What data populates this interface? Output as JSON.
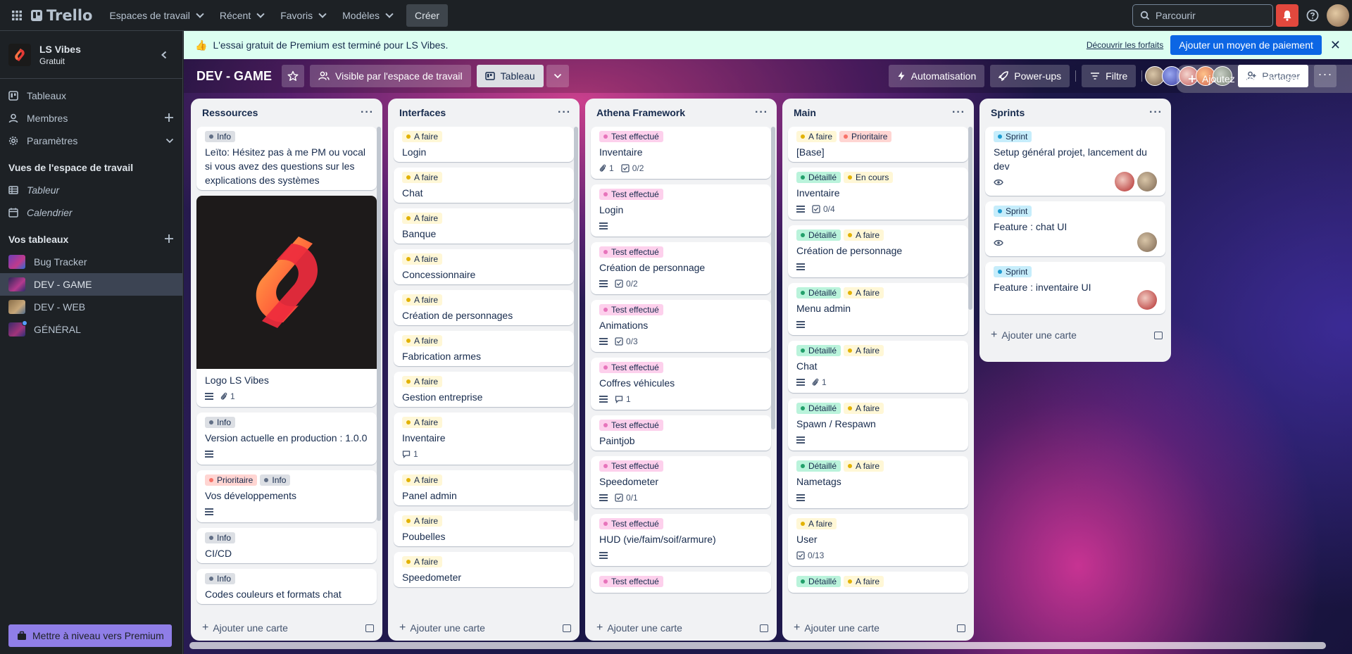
{
  "topbar": {
    "brand": "Trello",
    "nav": [
      "Espaces de travail",
      "Récent",
      "Favoris",
      "Modèles"
    ],
    "create": "Créer",
    "search_placeholder": "Parcourir"
  },
  "sidebar": {
    "workspace_name": "LS Vibes",
    "workspace_plan": "Gratuit",
    "items": [
      {
        "label": "Tableaux",
        "icon": "trello-board-icon"
      },
      {
        "label": "Membres",
        "icon": "person-icon"
      },
      {
        "label": "Paramètres",
        "icon": "gear-icon"
      }
    ],
    "views_title": "Vues de l'espace de travail",
    "views": [
      "Tableur",
      "Calendrier"
    ],
    "boards_title": "Vos tableaux",
    "boards": [
      "Bug Tracker",
      "DEV - GAME",
      "DEV - WEB",
      "GÉNÉRAL"
    ],
    "premium": "Mettre à niveau vers Premium"
  },
  "banner": {
    "text": "L'essai gratuit de Premium est terminé pour LS Vibes.",
    "link": "Découvrir les forfaits",
    "button": "Ajouter un moyen de paiement"
  },
  "board": {
    "title": "DEV - GAME",
    "visibility": "Visible par l'espace de travail",
    "view": "Tableau",
    "automation": "Automatisation",
    "powerups": "Power-ups",
    "filter": "Filtre",
    "share": "Partager",
    "add_list": "Ajoutez une autre liste",
    "add_card": "Ajouter une carte"
  },
  "lists": [
    {
      "name": "Ressources",
      "cards": [
        {
          "labels": [
            "Info"
          ],
          "title": "Leïto: Hésitez pas à me PM ou vocal si vous avez des questions sur les explications des systèmes"
        },
        {
          "cover": true,
          "title": "Logo LS Vibes",
          "desc": true,
          "attach": "1"
        },
        {
          "labels": [
            "Info"
          ],
          "title": "Version actuelle en production : 1.0.0",
          "desc": true
        },
        {
          "labels": [
            "Prioritaire",
            "Info"
          ],
          "title": "Vos développements",
          "desc": true
        },
        {
          "labels": [
            "Info"
          ],
          "title": "CI/CD"
        },
        {
          "labels": [
            "Info"
          ],
          "title": "Codes couleurs et formats chat"
        }
      ]
    },
    {
      "name": "Interfaces",
      "cards": [
        {
          "labels": [
            "A faire"
          ],
          "title": "Login"
        },
        {
          "labels": [
            "A faire"
          ],
          "title": "Chat"
        },
        {
          "labels": [
            "A faire"
          ],
          "title": "Banque"
        },
        {
          "labels": [
            "A faire"
          ],
          "title": "Concessionnaire"
        },
        {
          "labels": [
            "A faire"
          ],
          "title": "Création de personnages"
        },
        {
          "labels": [
            "A faire"
          ],
          "title": "Fabrication armes"
        },
        {
          "labels": [
            "A faire"
          ],
          "title": "Gestion entreprise"
        },
        {
          "labels": [
            "A faire"
          ],
          "title": "Inventaire",
          "comments": "1"
        },
        {
          "labels": [
            "A faire"
          ],
          "title": "Panel admin"
        },
        {
          "labels": [
            "A faire"
          ],
          "title": "Poubelles"
        },
        {
          "labels": [
            "A faire"
          ],
          "title": "Speedometer"
        }
      ]
    },
    {
      "name": "Athena Framework",
      "cards": [
        {
          "labels": [
            "Test effectué"
          ],
          "title": "Inventaire",
          "attach": "1",
          "check": "0/2"
        },
        {
          "labels": [
            "Test effectué"
          ],
          "title": "Login",
          "desc": true
        },
        {
          "labels": [
            "Test effectué"
          ],
          "title": "Création de personnage",
          "desc": true,
          "check": "0/2"
        },
        {
          "labels": [
            "Test effectué"
          ],
          "title": "Animations",
          "desc": true,
          "check": "0/3"
        },
        {
          "labels": [
            "Test effectué"
          ],
          "title": "Coffres véhicules",
          "desc": true,
          "comments": "1"
        },
        {
          "labels": [
            "Test effectué"
          ],
          "title": "Paintjob"
        },
        {
          "labels": [
            "Test effectué"
          ],
          "title": "Speedometer",
          "desc": true,
          "check": "0/1"
        },
        {
          "labels": [
            "Test effectué"
          ],
          "title": "HUD (vie/faim/soif/armure)",
          "desc": true
        },
        {
          "labels": [
            "Test effectué"
          ],
          "title": ""
        }
      ]
    },
    {
      "name": "Main",
      "cards": [
        {
          "labels": [
            "A faire",
            "Prioritaire"
          ],
          "title": "[Base]"
        },
        {
          "labels": [
            "Détaillé",
            "En cours"
          ],
          "title": "Inventaire",
          "desc": true,
          "check": "0/4"
        },
        {
          "labels": [
            "Détaillé",
            "A faire"
          ],
          "title": "Création de personnage",
          "desc": true
        },
        {
          "labels": [
            "Détaillé",
            "A faire"
          ],
          "title": "Menu admin",
          "desc": true
        },
        {
          "labels": [
            "Détaillé",
            "A faire"
          ],
          "title": "Chat",
          "desc": true,
          "attach": "1"
        },
        {
          "labels": [
            "Détaillé",
            "A faire"
          ],
          "title": "Spawn / Respawn",
          "desc": true
        },
        {
          "labels": [
            "Détaillé",
            "A faire"
          ],
          "title": "Nametags",
          "desc": true
        },
        {
          "labels": [
            "A faire"
          ],
          "title": "User",
          "check": "0/13"
        },
        {
          "labels": [
            "Détaillé",
            "A faire"
          ],
          "title": ""
        }
      ]
    },
    {
      "name": "Sprints",
      "cards": [
        {
          "labels": [
            "Sprint"
          ],
          "title": "Setup général projet, lancement du dev",
          "watch": true,
          "avatars": 2
        },
        {
          "labels": [
            "Sprint"
          ],
          "title": "Feature : chat UI",
          "watch": true,
          "avatars": 1
        },
        {
          "labels": [
            "Sprint"
          ],
          "title": "Feature : inventaire UI",
          "avatars": 1
        }
      ]
    }
  ],
  "label_styles": {
    "Info": "l-info",
    "A faire": "l-afaire",
    "Test effectué": "l-test",
    "Prioritaire": "l-prio",
    "Détaillé": "l-detail",
    "En cours": "l-encours",
    "Sprint": "l-sprint"
  },
  "colors": {
    "accent": "#0c66e4",
    "banner": "#dcfff1",
    "premium": "#8f7ee7",
    "bell": "#e2483d"
  }
}
